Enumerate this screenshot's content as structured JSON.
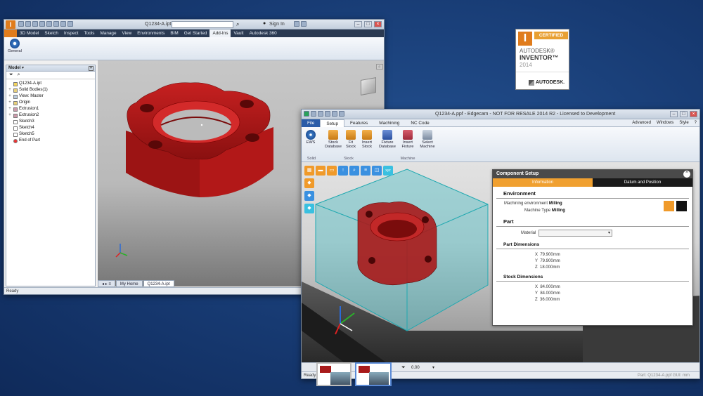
{
  "inventor": {
    "file_title": "Q1234-A.ipt",
    "sign_in": "Sign In",
    "menu": [
      "3D Model",
      "Sketch",
      "Inspect",
      "Tools",
      "Manage",
      "View",
      "Environments",
      "BIM",
      "Get Started",
      "Add-Ins",
      "Vault",
      "Autodesk 360"
    ],
    "active_menu": "Add-Ins",
    "ribbon_button": "General",
    "browser_title": "Model",
    "tree": [
      {
        "label": "Q1234-A.ipt",
        "exp": ""
      },
      {
        "label": "Solid Bodies(1)",
        "exp": "+"
      },
      {
        "label": "View: Master",
        "exp": "+"
      },
      {
        "label": "Origin",
        "exp": "+"
      },
      {
        "label": "Extrusion1",
        "exp": "+"
      },
      {
        "label": "Extrusion2",
        "exp": "+"
      },
      {
        "label": "Sketch3",
        "exp": ""
      },
      {
        "label": "Sketch4",
        "exp": ""
      },
      {
        "label": "Sketch5",
        "exp": ""
      },
      {
        "label": "End of Part",
        "exp": ""
      }
    ],
    "tabs": [
      "My Home",
      "Q1234-A.ipt"
    ],
    "status": "Ready"
  },
  "certified": {
    "badge": "CERTIFIED",
    "line1": "AUTODESK®",
    "line2": "INVENTOR™",
    "year": "2014",
    "brand": "AUTODESK."
  },
  "edgecam": {
    "title": "Q1234-A.ppf - Edgecam - NOT FOR RESALE 2014 R2 - Licensed to Development",
    "tabs": [
      "File",
      "Setup",
      "Features",
      "Machining",
      "NC Code"
    ],
    "active_tab": "Setup",
    "right_menu": [
      "Advanced",
      "Windows",
      "Style",
      "?"
    ],
    "ribbon_buttons": [
      {
        "label": "EWS",
        "group": "Solid"
      },
      {
        "label": "Stock Database",
        "group": "Stock"
      },
      {
        "label": "Fit Stock",
        "group": "Stock"
      },
      {
        "label": "Insert Stock",
        "group": "Stock"
      },
      {
        "label": "Fixture Database",
        "group": "Fixture"
      },
      {
        "label": "Insert Fixture",
        "group": "Fixture"
      },
      {
        "label": "Select Machine",
        "group": "Machine"
      }
    ],
    "groups": [
      "Solid",
      "Stock",
      "Machine"
    ],
    "status": "Ready",
    "zoom": "0.00",
    "status_right": "Part: Q1234-A.ppf  GUI: mm"
  },
  "component_setup": {
    "title": "Component Setup",
    "tabs": [
      "Information",
      "Datum and Position"
    ],
    "active_tab": "Information",
    "environment": {
      "heading": "Environment",
      "machining_env_label": "Machining environment",
      "machining_env": "Milling",
      "machine_type_label": "Machine Type",
      "machine_type": "Milling"
    },
    "part": {
      "heading": "Part",
      "material_label": "Material",
      "material_value": ""
    },
    "part_dims": {
      "heading": "Part Dimensions",
      "x": "79.900mm",
      "y": "79.900mm",
      "z": "18.000mm"
    },
    "stock_dims": {
      "heading": "Stock Dimensions",
      "x": "84.000mm",
      "y": "84.000mm",
      "z": "36.000mm"
    }
  },
  "colors": {
    "part": "#b11a1a",
    "stock": "#2ab8c0",
    "orange": "#f09a2a",
    "ribbon_file": "#2a5ca8"
  }
}
